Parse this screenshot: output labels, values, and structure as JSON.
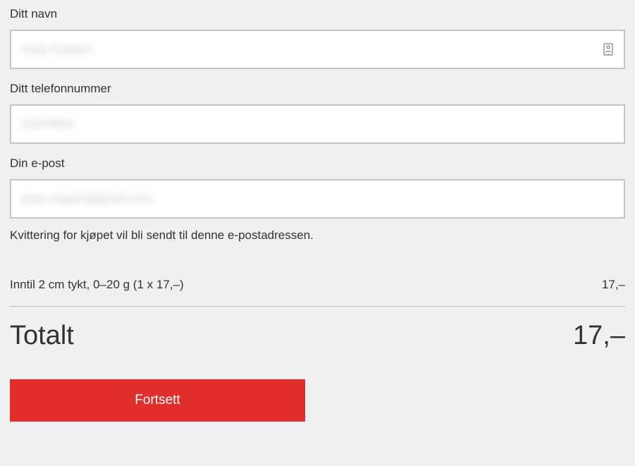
{
  "form": {
    "name": {
      "label": "Ditt navn",
      "value": "Joop Cuppen"
    },
    "phone": {
      "label": "Ditt telefonnummer",
      "value": "41823854"
    },
    "email": {
      "label": "Din e-post",
      "value": "joop.cuppen@gmail.com",
      "helper": "Kvittering for kjøpet vil bli sendt til denne e-postadressen."
    }
  },
  "summary": {
    "line_item": {
      "description": "Inntil 2 cm tykt, 0–20 g (1 x 17,–)",
      "price": "17,–"
    },
    "total": {
      "label": "Totalt",
      "value": "17,–"
    }
  },
  "actions": {
    "continue_label": "Fortsett"
  },
  "colors": {
    "accent": "#e22d2d",
    "text": "#323232",
    "border": "#c5c5c5",
    "background": "#f0f0f0"
  }
}
